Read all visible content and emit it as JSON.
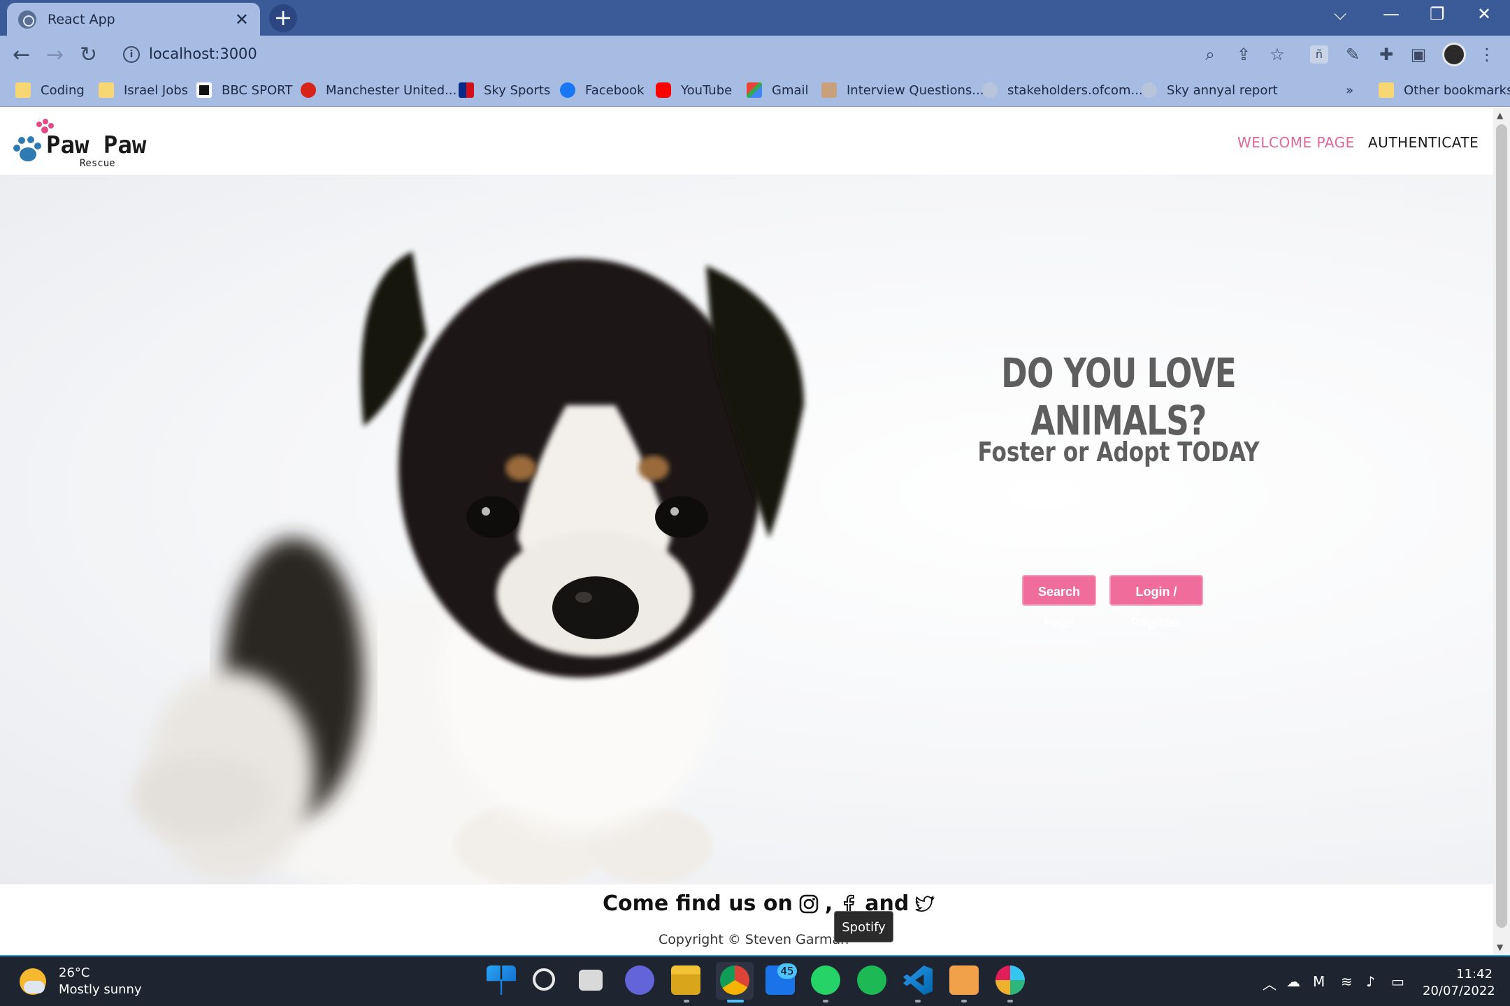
{
  "browser": {
    "tab_title": "React App",
    "tab_close": "✕",
    "new_tab": "+",
    "url": "localhost:3000",
    "bookmarks": [
      {
        "label": "Coding",
        "icon": "folder-icon"
      },
      {
        "label": "Israel Jobs",
        "icon": "folder-icon"
      },
      {
        "label": "BBC SPORT",
        "icon": "bbc-icon"
      },
      {
        "label": "Manchester United...",
        "icon": "manutd-icon"
      },
      {
        "label": "Sky Sports",
        "icon": "skysports-icon"
      },
      {
        "label": "Facebook",
        "icon": "facebook-icon"
      },
      {
        "label": "YouTube",
        "icon": "youtube-icon"
      },
      {
        "label": "Gmail",
        "icon": "gmail-icon"
      },
      {
        "label": "Interview Questions...",
        "icon": "page-icon"
      },
      {
        "label": "stakeholders.ofcom...",
        "icon": "globe-icon"
      },
      {
        "label": "Sky annyal report",
        "icon": "globe-icon"
      }
    ],
    "bookmarks_overflow": "»",
    "other_bookmarks": "Other bookmarks"
  },
  "site": {
    "logo_title": "Paw Paw",
    "logo_sub": "Rescue",
    "nav": [
      {
        "label": "WELCOME PAGE",
        "color": "#e0679a"
      },
      {
        "label": "AUTHENTICATE",
        "color": "#1a1a1a"
      }
    ]
  },
  "hero": {
    "headline": "DO YOU LOVE ANIMALS?",
    "subheadline": "Foster or Adopt TODAY",
    "buttons": [
      "Search Page",
      "Login / Register"
    ],
    "accent": "#f06c9b"
  },
  "footer": {
    "find_text": "Come find us on",
    "comma": ",",
    "and_text": "and",
    "copyright": "Copyright © Steven Garman",
    "tooltip": "Spotify"
  },
  "taskbar": {
    "temperature": "26°C",
    "weather": "Mostly sunny",
    "mail_badge": "45",
    "time": "11:42",
    "date": "20/07/2022"
  }
}
